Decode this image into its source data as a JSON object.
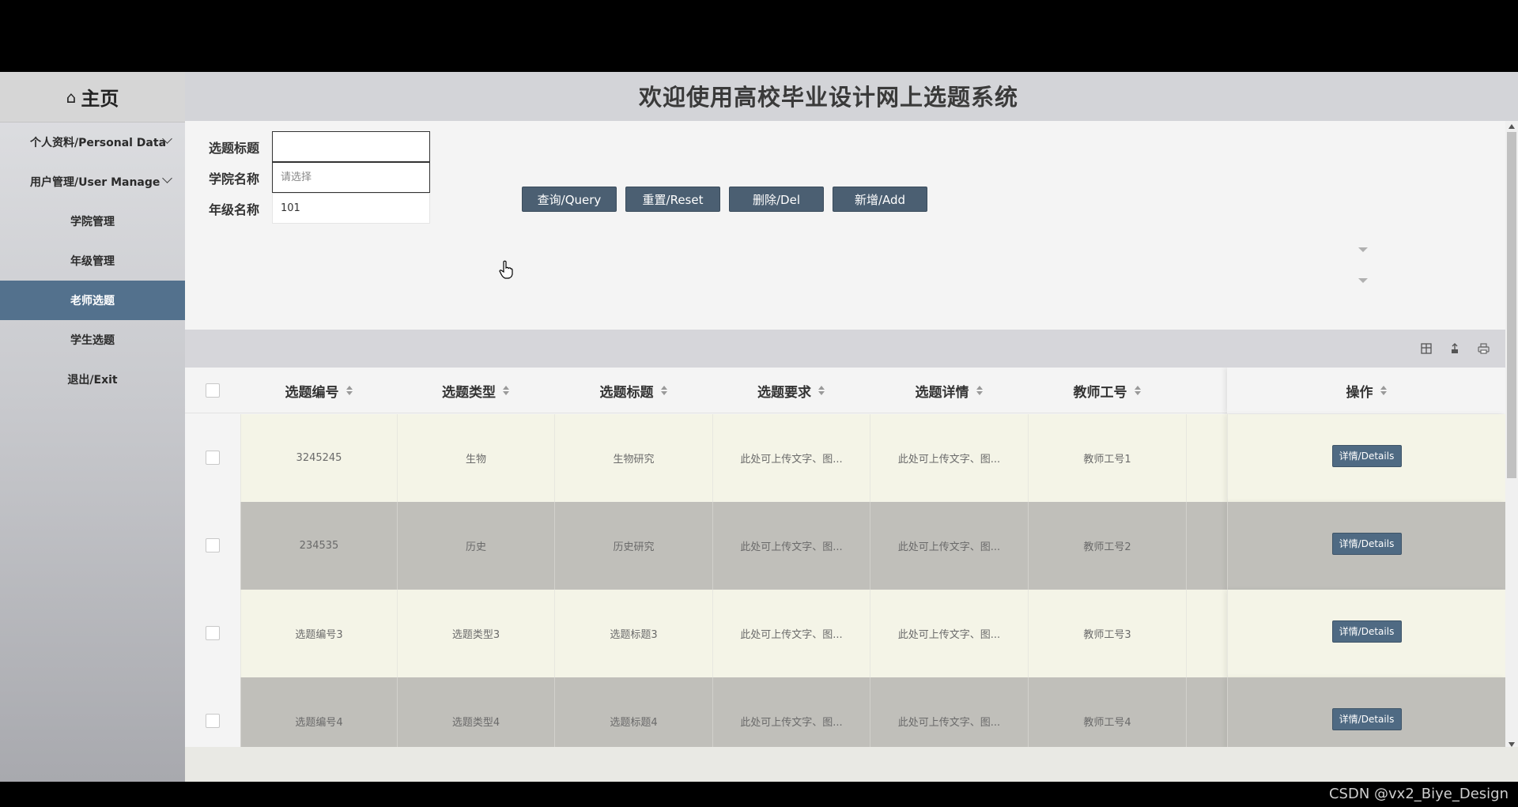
{
  "sidebar": {
    "home_label": "主页",
    "groups": [
      {
        "label": "个人资料/Personal Data"
      },
      {
        "label": "用户管理/User Manage"
      }
    ],
    "items": [
      {
        "label": "学院管理"
      },
      {
        "label": "年级管理"
      },
      {
        "label": "老师选题",
        "active": true
      },
      {
        "label": "学生选题"
      },
      {
        "label": "退出/Exit"
      }
    ]
  },
  "header": {
    "title": "欢迎使用高校毕业设计网上选题系统"
  },
  "form": {
    "title_label": "选题标题",
    "title_value": "",
    "college_label": "学院名称",
    "college_placeholder": "请选择",
    "grade_label": "年级名称",
    "grade_value": "101",
    "query_label": "查询/Query",
    "reset_label": "重置/Reset",
    "delete_label": "删除/Del",
    "add_label": "新增/Add"
  },
  "table": {
    "columns": [
      "选题编号",
      "选题类型",
      "选题标题",
      "选题要求",
      "选题详情",
      "教师工号",
      "操作"
    ],
    "detail_label": "详情/Details",
    "rows": [
      {
        "code": "3245245",
        "type": "生物",
        "title": "生物研究",
        "requirement": "此处可上传文字、图...",
        "details": "此处可上传文字、图...",
        "teacher": "教师工号1"
      },
      {
        "code": "234535",
        "type": "历史",
        "title": "历史研究",
        "requirement": "此处可上传文字、图...",
        "details": "此处可上传文字、图...",
        "teacher": "教师工号2"
      },
      {
        "code": "选题编号3",
        "type": "选题类型3",
        "title": "选题标题3",
        "requirement": "此处可上传文字、图...",
        "details": "此处可上传文字、图...",
        "teacher": "教师工号3"
      },
      {
        "code": "选题编号4",
        "type": "选题类型4",
        "title": "选题标题4",
        "requirement": "此处可上传文字、图...",
        "details": "此处可上传文字、图...",
        "teacher": "教师工号4"
      }
    ]
  },
  "colors": {
    "odd_row": "#f4f4e7",
    "even_row": "#c0bfba",
    "active_menu": "#53718d",
    "button": "#4b5f72"
  },
  "watermark": "CSDN @vx2_Biye_Design"
}
